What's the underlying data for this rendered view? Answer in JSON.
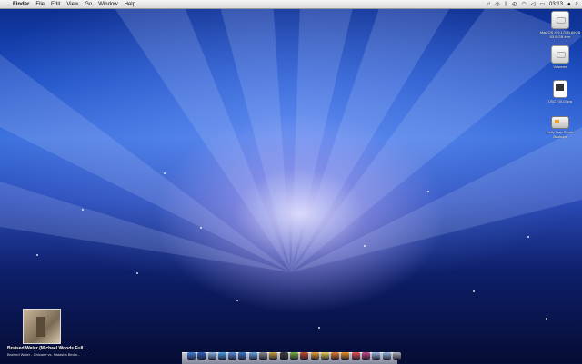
{
  "menubar": {
    "apple": "",
    "items": [
      "Finder",
      "File",
      "Edit",
      "View",
      "Go",
      "Window",
      "Help"
    ],
    "status": {
      "clock": "03:13"
    }
  },
  "desktop_icons": [
    {
      "label": "Mac OS X 9.17GB 69GB 53.6 GB free",
      "kind": "disk"
    },
    {
      "label": "Volumes",
      "kind": "disk"
    },
    {
      "label": "DSC_0013.jpg",
      "kind": "doc"
    },
    {
      "label": "Daily Trap Studio Backups",
      "kind": "drive"
    }
  ],
  "now_playing": {
    "title": "Bruised Water (Michael Woods Full ...",
    "subtitle": "Bruised Water - Chicane vs. Natasha Bedin..."
  },
  "dock": {
    "apps": [
      {
        "name": "finder-icon",
        "color": "#3f7fe0"
      },
      {
        "name": "word-icon",
        "color": "#2d5fc0"
      },
      {
        "name": "mail-icon",
        "color": "#8fb6e8"
      },
      {
        "name": "safari-icon",
        "color": "#4aa0e8"
      },
      {
        "name": "app-store-icon",
        "color": "#5a8fd8"
      },
      {
        "name": "globe-icon",
        "color": "#3a79c9"
      },
      {
        "name": "itunes-icon",
        "color": "#6aa7e6"
      },
      {
        "name": "system-preferences-icon",
        "color": "#8a8a8a"
      },
      {
        "name": "photos-icon",
        "color": "#c8a040"
      },
      {
        "name": "terminal-icon",
        "color": "#3a3a3a"
      },
      {
        "name": "dreamweaver-icon",
        "color": "#78b040"
      },
      {
        "name": "flash-icon",
        "color": "#c84a28"
      },
      {
        "name": "illustrator-icon",
        "color": "#e8a030"
      },
      {
        "name": "stickies-icon",
        "color": "#e8d050"
      },
      {
        "name": "firefox-icon",
        "color": "#e87a28"
      },
      {
        "name": "vlc-icon",
        "color": "#f09020"
      },
      {
        "name": "calendar-icon",
        "color": "#e85050"
      },
      {
        "name": "chat-icon",
        "color": "#c84a8a"
      },
      {
        "name": "folder-icon",
        "color": "#9ab8e0"
      },
      {
        "name": "downloads-icon",
        "color": "#9ab8e0"
      },
      {
        "name": "trash-icon",
        "color": "#b0b0b8"
      }
    ]
  }
}
